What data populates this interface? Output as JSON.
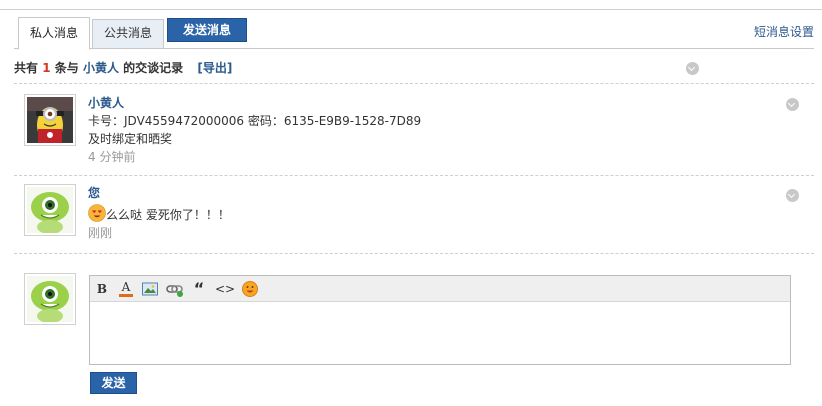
{
  "tabs": {
    "private_label": "私人消息",
    "public_label": "公共消息",
    "send_label": "发送消息"
  },
  "settings_label": "短消息设置",
  "summary": {
    "prefix": "共有",
    "count": "1",
    "middle": "条与",
    "name": "小黄人",
    "suffix": "的交谈记录",
    "export_label": "[导出]"
  },
  "messages": [
    {
      "sender": "小黄人",
      "line1": "卡号：JDV4559472000006 密码：6135-E9B9-1528-7D89",
      "line2": "及时绑定和晒奖",
      "time": "4 分钟前",
      "avatar": "minion-avatar-icon"
    },
    {
      "sender": "您",
      "text": "么么哒 爱死你了！！！",
      "time": "刚刚",
      "avatar": "green-monster-avatar-icon",
      "emoji": "heart-eyes-emoji-icon"
    }
  ],
  "editor": {
    "tools": [
      "bold-icon",
      "font-color-icon",
      "image-icon",
      "link-icon",
      "quote-icon",
      "code-icon",
      "emoji-icon"
    ],
    "bold_glyph": "B",
    "fontcolor_glyph": "A",
    "quote_glyph": "“",
    "code_glyph": "<>",
    "value": "",
    "send_label": "发送"
  },
  "colors": {
    "accent": "#2a63a8",
    "link": "#2d5a8c",
    "highlight": "#d8371c",
    "muted": "#999999"
  }
}
